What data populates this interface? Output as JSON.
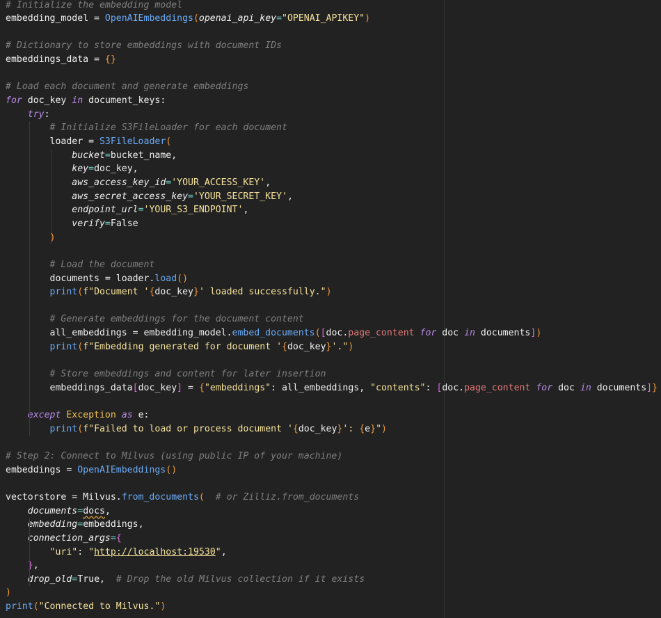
{
  "editor": {
    "lines": [
      [
        [
          "# Initialize the embedding model",
          "comment"
        ]
      ],
      [
        [
          "embedding_model = ",
          "plain"
        ],
        [
          "OpenAIEmbeddings",
          "func"
        ],
        [
          "(",
          "bracket"
        ],
        [
          "openai_api_key",
          "param"
        ],
        [
          "=",
          "op"
        ],
        [
          "\"OPENAI_APIKEY\"",
          "string"
        ],
        [
          ")",
          "bracket"
        ]
      ],
      [],
      [
        [
          "# Dictionary to store embeddings with document IDs",
          "comment"
        ]
      ],
      [
        [
          "embeddings_data = ",
          "plain"
        ],
        [
          "{}",
          "bracket"
        ]
      ],
      [],
      [
        [
          "# Load each document and generate embeddings",
          "comment"
        ]
      ],
      [
        [
          "for",
          "keyword"
        ],
        [
          " doc_key ",
          "plain"
        ],
        [
          "in",
          "keyword"
        ],
        [
          " document_keys:",
          "plain"
        ]
      ],
      [
        [
          "    ",
          "plain"
        ],
        [
          "try",
          "keyword"
        ],
        [
          ":",
          "plain"
        ]
      ],
      [
        [
          "        # Initialize S3FileLoader for each document",
          "comment"
        ]
      ],
      [
        [
          "        loader = ",
          "plain"
        ],
        [
          "S3FileLoader",
          "func"
        ],
        [
          "(",
          "bracket"
        ]
      ],
      [
        [
          "            ",
          "plain"
        ],
        [
          "bucket",
          "param"
        ],
        [
          "=",
          "op"
        ],
        [
          "bucket_name,",
          "plain"
        ]
      ],
      [
        [
          "            ",
          "plain"
        ],
        [
          "key",
          "param"
        ],
        [
          "=",
          "op"
        ],
        [
          "doc_key,",
          "plain"
        ]
      ],
      [
        [
          "            ",
          "plain"
        ],
        [
          "aws_access_key_id",
          "param"
        ],
        [
          "=",
          "op"
        ],
        [
          "'YOUR_ACCESS_KEY'",
          "string"
        ],
        [
          ",",
          "plain"
        ]
      ],
      [
        [
          "            ",
          "plain"
        ],
        [
          "aws_secret_access_key",
          "param"
        ],
        [
          "=",
          "op"
        ],
        [
          "'YOUR_SECRET_KEY'",
          "string"
        ],
        [
          ",",
          "plain"
        ]
      ],
      [
        [
          "            ",
          "plain"
        ],
        [
          "endpoint_url",
          "param"
        ],
        [
          "=",
          "op"
        ],
        [
          "'YOUR_S3_ENDPOINT'",
          "string"
        ],
        [
          ",",
          "plain"
        ]
      ],
      [
        [
          "            ",
          "plain"
        ],
        [
          "verify",
          "param"
        ],
        [
          "=",
          "op"
        ],
        [
          "False",
          "const"
        ]
      ],
      [
        [
          "        ",
          "plain"
        ],
        [
          ")",
          "bracket"
        ]
      ],
      [],
      [
        [
          "        # Load the document",
          "comment"
        ]
      ],
      [
        [
          "        documents = loader.",
          "plain"
        ],
        [
          "load",
          "func"
        ],
        [
          "()",
          "bracket"
        ]
      ],
      [
        [
          "        ",
          "plain"
        ],
        [
          "print",
          "func"
        ],
        [
          "(",
          "bracket"
        ],
        [
          "f\"Document '",
          "string"
        ],
        [
          "{",
          "bracket"
        ],
        [
          "doc_key",
          "plain"
        ],
        [
          "}",
          "bracket"
        ],
        [
          "' loaded successfully.\"",
          "string"
        ],
        [
          ")",
          "bracket"
        ]
      ],
      [],
      [
        [
          "        # Generate embeddings for the document content",
          "comment"
        ]
      ],
      [
        [
          "        all_embeddings = embedding_model.",
          "plain"
        ],
        [
          "embed_documents",
          "func"
        ],
        [
          "(",
          "bracket"
        ],
        [
          "[",
          "brace2"
        ],
        [
          "doc.",
          "plain"
        ],
        [
          "page_content",
          "prop"
        ],
        [
          " ",
          "plain"
        ],
        [
          "for",
          "keyword"
        ],
        [
          " doc ",
          "plain"
        ],
        [
          "in",
          "keyword"
        ],
        [
          " documents",
          "plain"
        ],
        [
          "]",
          "brace2"
        ],
        [
          ")",
          "bracket"
        ]
      ],
      [
        [
          "        ",
          "plain"
        ],
        [
          "print",
          "func"
        ],
        [
          "(",
          "bracket"
        ],
        [
          "f\"Embedding generated for document '",
          "string"
        ],
        [
          "{",
          "bracket"
        ],
        [
          "doc_key",
          "plain"
        ],
        [
          "}",
          "bracket"
        ],
        [
          "'.\"",
          "string"
        ],
        [
          ")",
          "bracket"
        ]
      ],
      [],
      [
        [
          "        # Store embeddings and content for later insertion",
          "comment"
        ]
      ],
      [
        [
          "        embeddings_data",
          "plain"
        ],
        [
          "[",
          "brace2"
        ],
        [
          "doc_key",
          "plain"
        ],
        [
          "]",
          "brace2"
        ],
        [
          " = ",
          "plain"
        ],
        [
          "{",
          "bracket"
        ],
        [
          "\"embeddings\"",
          "string"
        ],
        [
          ": all_embeddings, ",
          "plain"
        ],
        [
          "\"contents\"",
          "string"
        ],
        [
          ": ",
          "plain"
        ],
        [
          "[",
          "brace2"
        ],
        [
          "doc.",
          "plain"
        ],
        [
          "page_content",
          "prop"
        ],
        [
          " ",
          "plain"
        ],
        [
          "for",
          "keyword"
        ],
        [
          " doc ",
          "plain"
        ],
        [
          "in",
          "keyword"
        ],
        [
          " documents",
          "plain"
        ],
        [
          "]",
          "brace2"
        ],
        [
          "}",
          "bracket"
        ]
      ],
      [],
      [
        [
          "    ",
          "plain"
        ],
        [
          "except",
          "keyword"
        ],
        [
          " ",
          "plain"
        ],
        [
          "Exception",
          "class"
        ],
        [
          " ",
          "plain"
        ],
        [
          "as",
          "keyword"
        ],
        [
          " e:",
          "plain"
        ]
      ],
      [
        [
          "        ",
          "plain"
        ],
        [
          "print",
          "func"
        ],
        [
          "(",
          "bracket"
        ],
        [
          "f\"Failed to load or process document '",
          "string"
        ],
        [
          "{",
          "bracket"
        ],
        [
          "doc_key",
          "plain"
        ],
        [
          "}",
          "bracket"
        ],
        [
          "': ",
          "string"
        ],
        [
          "{",
          "bracket"
        ],
        [
          "e",
          "plain"
        ],
        [
          "}",
          "bracket"
        ],
        [
          "\"",
          "string"
        ],
        [
          ")",
          "bracket"
        ]
      ],
      [],
      [
        [
          "# Step 2: Connect to Milvus (using public IP of your machine)",
          "comment"
        ]
      ],
      [
        [
          "embeddings = ",
          "plain"
        ],
        [
          "OpenAIEmbeddings",
          "func"
        ],
        [
          "()",
          "bracket"
        ]
      ],
      [],
      [
        [
          "vectorstore = Milvus.",
          "plain"
        ],
        [
          "from_documents",
          "func"
        ],
        [
          "(",
          "bracket"
        ],
        [
          "  # or Zilliz.from_documents",
          "comment"
        ]
      ],
      [
        [
          "    ",
          "plain"
        ],
        [
          "documents",
          "param"
        ],
        [
          "=",
          "op"
        ],
        [
          "docs",
          "squiggle"
        ],
        [
          ",",
          "plain"
        ]
      ],
      [
        [
          "    ",
          "plain"
        ],
        [
          "embedding",
          "param"
        ],
        [
          "=",
          "op"
        ],
        [
          "embeddings,",
          "plain"
        ]
      ],
      [
        [
          "    ",
          "plain"
        ],
        [
          "connection_args",
          "param"
        ],
        [
          "=",
          "op"
        ],
        [
          "{",
          "brace2"
        ]
      ],
      [
        [
          "        ",
          "plain"
        ],
        [
          "\"uri\"",
          "string"
        ],
        [
          ": ",
          "plain"
        ],
        [
          "\"",
          "string"
        ],
        [
          "http://localhost:19530",
          "link"
        ],
        [
          "\"",
          "string"
        ],
        [
          ",",
          "plain"
        ]
      ],
      [
        [
          "    ",
          "plain"
        ],
        [
          "}",
          "brace2"
        ],
        [
          ",",
          "plain"
        ]
      ],
      [
        [
          "    ",
          "plain"
        ],
        [
          "drop_old",
          "param"
        ],
        [
          "=",
          "op"
        ],
        [
          "True",
          "const"
        ],
        [
          ",",
          "plain"
        ],
        [
          "  # Drop the old Milvus collection if it exists",
          "comment"
        ]
      ],
      [
        [
          ")",
          "bracket"
        ]
      ],
      [
        [
          "print",
          "func"
        ],
        [
          "(",
          "bracket"
        ],
        [
          "\"Connected to Milvus.\"",
          "string"
        ],
        [
          ")",
          "bracket"
        ]
      ]
    ]
  }
}
